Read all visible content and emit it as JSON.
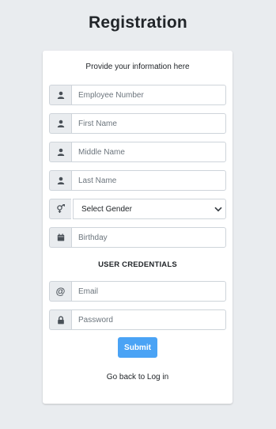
{
  "header": {
    "title": "Registration"
  },
  "form": {
    "subtitle": "Provide your information here",
    "employee_number": {
      "placeholder": "Employee Number",
      "icon": "user-icon"
    },
    "first_name": {
      "placeholder": "First Name",
      "icon": "user-icon"
    },
    "middle_name": {
      "placeholder": "Middle Name",
      "icon": "user-icon"
    },
    "last_name": {
      "placeholder": "Last Name",
      "icon": "user-icon"
    },
    "gender": {
      "selected": "Select Gender",
      "icon": "gender-icon"
    },
    "birthday": {
      "placeholder": "Birthday",
      "icon": "calendar-icon"
    },
    "credentials_heading": "USER CREDENTIALS",
    "email": {
      "placeholder": "Email",
      "icon_text": "@"
    },
    "password": {
      "placeholder": "Password",
      "icon": "lock-icon"
    },
    "submit_label": "Submit",
    "back_link": "Go back to Log in"
  },
  "colors": {
    "background": "#e9ecef",
    "card": "#ffffff",
    "accent": "#4aa3f5",
    "addon": "#e9ecef",
    "border": "#ced4da"
  }
}
